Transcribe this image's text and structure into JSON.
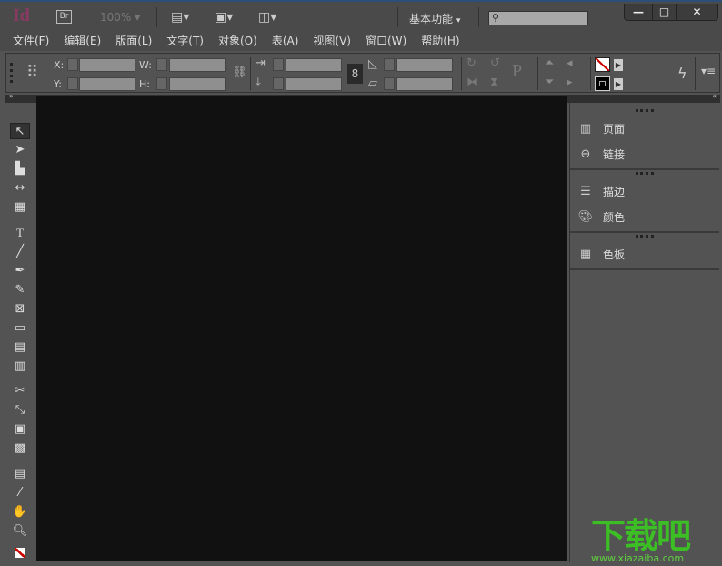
{
  "app": {
    "logo": "Id",
    "bridge": "Br",
    "zoom": "100%",
    "workspace": "基本功能",
    "search_placeholder": "",
    "window_buttons": [
      "—",
      "□",
      "✕"
    ]
  },
  "menu": [
    "文件(F)",
    "编辑(E)",
    "版面(L)",
    "文字(T)",
    "对象(O)",
    "表(A)",
    "视图(V)",
    "窗口(W)",
    "帮助(H)"
  ],
  "control": {
    "x_label": "X:",
    "y_label": "Y:",
    "w_label": "W:",
    "h_label": "H:",
    "x": "",
    "y": "",
    "w": "",
    "h": ""
  },
  "panels": [
    {
      "label": "页面",
      "icon": "pages-icon"
    },
    {
      "label": "链接",
      "icon": "links-icon"
    },
    {
      "label": "描边",
      "icon": "stroke-icon"
    },
    {
      "label": "颜色",
      "icon": "color-icon"
    },
    {
      "label": "色板",
      "icon": "swatches-icon"
    }
  ],
  "watermark": {
    "text": "下载吧",
    "url": "www.xiazaiba.com"
  }
}
